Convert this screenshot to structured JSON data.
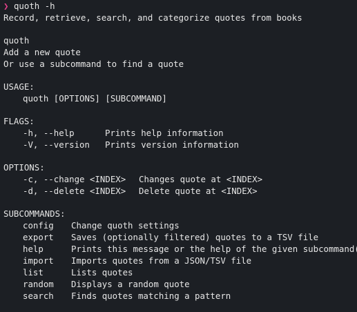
{
  "prompt": {
    "symbol": "❯",
    "command": "quoth -h"
  },
  "description": "Record, retrieve, search, and categorize quotes from books",
  "intro": {
    "name": "quoth",
    "line1": "Add a new quote",
    "line2": "Or use a subcommand to find a quote"
  },
  "usage": {
    "heading": "USAGE:",
    "text": "quoth [OPTIONS] [SUBCOMMAND]"
  },
  "flags": {
    "heading": "FLAGS:",
    "items": [
      {
        "key": "-h, --help",
        "desc": "Prints help information"
      },
      {
        "key": "-V, --version",
        "desc": "Prints version information"
      }
    ]
  },
  "options": {
    "heading": "OPTIONS:",
    "items": [
      {
        "key": "-c, --change <INDEX>",
        "desc": "Changes quote at <INDEX>"
      },
      {
        "key": "-d, --delete <INDEX>",
        "desc": "Delete quote at <INDEX>"
      }
    ]
  },
  "subcommands": {
    "heading": "SUBCOMMANDS:",
    "items": [
      {
        "key": "config",
        "desc": "Change quoth settings"
      },
      {
        "key": "export",
        "desc": "Saves (optionally filtered) quotes to a TSV file"
      },
      {
        "key": "help",
        "desc": "Prints this message or the help of the given subcommand(s)"
      },
      {
        "key": "import",
        "desc": "Imports quotes from a JSON/TSV file"
      },
      {
        "key": "list",
        "desc": "Lists quotes"
      },
      {
        "key": "random",
        "desc": "Displays a random quote"
      },
      {
        "key": "search",
        "desc": "Finds quotes matching a pattern"
      }
    ]
  },
  "colors": {
    "background": "#1c1f24",
    "foreground": "#e6e6e6",
    "prompt": "#e4408b"
  }
}
